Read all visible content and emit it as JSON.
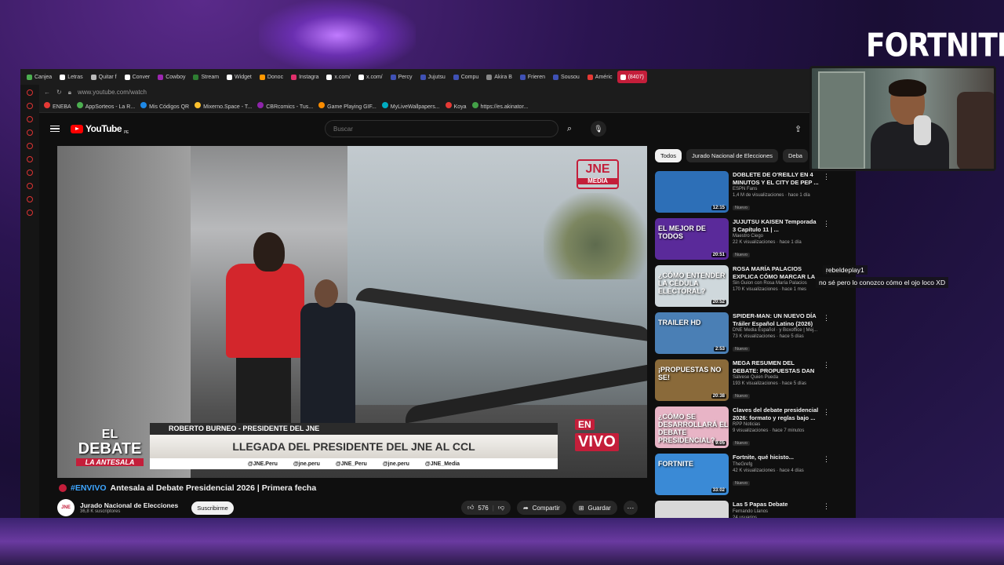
{
  "overlay": {
    "game_logo": "FORTNITE",
    "chat_user": "rebeldeplay1",
    "chat_message": "no sé pero lo conozco cómo el ojo loco XD"
  },
  "browser": {
    "url": "www.youtube.com/watch",
    "tabs": [
      {
        "label": "Canjea",
        "color": "#4caf50"
      },
      {
        "label": "Letras",
        "color": "#ffffff"
      },
      {
        "label": "Quitar f",
        "color": "#bbbbbb"
      },
      {
        "label": "Conver",
        "color": "#ffffff"
      },
      {
        "label": "Cowboy",
        "color": "#9c27b0"
      },
      {
        "label": "Stream",
        "color": "#2e7d32"
      },
      {
        "label": "Widget",
        "color": "#ffffff"
      },
      {
        "label": "Donoc",
        "color": "#ff9800"
      },
      {
        "label": "Instagra",
        "color": "#e1306c"
      },
      {
        "label": "x.com/",
        "color": "#ffffff"
      },
      {
        "label": "x.com/",
        "color": "#ffffff"
      },
      {
        "label": "Percy",
        "color": "#3f51b5"
      },
      {
        "label": "Jujutsu",
        "color": "#3f51b5"
      },
      {
        "label": "Compu",
        "color": "#3f51b5"
      },
      {
        "label": "Akira B",
        "color": "#888888"
      },
      {
        "label": "Frieren",
        "color": "#3f51b5"
      },
      {
        "label": "Sousou",
        "color": "#3f51b5"
      },
      {
        "label": "Améric",
        "color": "#e53935"
      },
      {
        "label": "(8407)",
        "color": "#ffffff",
        "active": true
      }
    ],
    "bookmarks": [
      "ENEBA",
      "AppSorteos - La R...",
      "Mis Códigos QR",
      "Mixerno.Space - T...",
      "CBRcomics - Tus...",
      "Game Playing GIF...",
      "MyLiveWallpapers...",
      "Koya",
      "https://es.akinator..."
    ]
  },
  "youtube": {
    "logo_text": "YouTube",
    "logo_country": "PE",
    "search_placeholder": "Buscar",
    "video": {
      "overlay_brand": "JNE",
      "overlay_brand_sub": "MEDIA",
      "badge_line1": "EL",
      "badge_line2": "DEBATE",
      "badge_line3": "LA ANTESALA",
      "name_strip": "ROBERTO BURNEO - PRESIDENTE DEL JNE",
      "headline": "LLEGADA DEL PRESIDENTE DEL JNE AL CCL",
      "socials": [
        "@JNE.Peru",
        "@jne.peru",
        "@JNE_Peru",
        "@jne.peru",
        "@JNE_Media"
      ],
      "live_en": "EN",
      "live_vivo": "VIVO"
    },
    "title_hashtag": "#ENVIVO",
    "title_text": "Antesala al Debate Presidencial 2026 | Primera fecha",
    "channel_name": "Jurado Nacional de Elecciones",
    "channel_subs": "36,8 K suscriptores",
    "channel_avatar_text": "JNE",
    "subscribe_label": "Suscribirme",
    "like_count": "576",
    "share_label": "Compartir",
    "save_label": "Guardar",
    "chips": [
      "Todos",
      "Jurado Nacional de Elecciones",
      "Deba"
    ],
    "recommendations": [
      {
        "title": "DOBLETE DE O'REILLY EN 4 MINUTOS Y EL CITY DE PEP ...",
        "channel": "ESPN Fans",
        "stats": "1,4 M de visualizaciones · hace 1 día",
        "badge": "Nuevo",
        "duration": "12:15",
        "thumb_text": "",
        "thumb_color": "#2d6fb7"
      },
      {
        "title": "JUJUTSU KAISEN Temporada 3 Capítulo 11 | ...",
        "channel": "Maestro Ciego",
        "stats": "22 K visualizaciones · hace 1 día",
        "badge": "Nuevo",
        "duration": "20:51",
        "thumb_text": "EL MEJOR DE TODOS",
        "thumb_color": "#5a2a9a"
      },
      {
        "title": "ROSA MARÍA PALACIOS EXPLICA CÓMO MARCAR LA ...",
        "channel": "Sin Guion con Rosa María Palacios",
        "stats": "170 K visualizaciones · hace 1 mes",
        "badge": "",
        "duration": "20:52",
        "thumb_text": "¿CÓMO ENTENDER LA CÉDULA ELECTORAL?",
        "thumb_color": "#cfd8dc"
      },
      {
        "title": "SPIDER-MAN: UN NUEVO DÍA Tráiler Español Latino (2026)",
        "channel": "DNE Media Español · y Boxoffice | Mej...",
        "stats": "73 K visualizaciones · hace 5 días",
        "badge": "Nuevo",
        "duration": "2:53",
        "thumb_text": "TRAILER HD",
        "thumb_color": "#4a7fb5"
      },
      {
        "title": "MEGA RESUMEN DEL DEBATE: PROPUESTAS DAN PENA ...",
        "channel": "Sálvese Quien Pueda",
        "stats": "193 K visualizaciones · hace 5 días",
        "badge": "Nuevo",
        "duration": "20:38",
        "thumb_text": "¡PROPUESTAS NO SE!",
        "thumb_color": "#8a6a3a"
      },
      {
        "title": "Claves del debate presidencial 2026: formato y reglas bajo ...",
        "channel": "RPP Noticias",
        "stats": "9 visualizaciones · hace 7 minutos",
        "badge": "Nuevo",
        "duration": "9:05",
        "thumb_text": "¿CÓMO SE DESARROLLARÁ EL DEBATE PRESIDENCIAL?",
        "thumb_color": "#e8b4c6"
      },
      {
        "title": "Fortnite, qué hicisto...",
        "channel": "TheGrefg",
        "stats": "42 K visualizaciones · hace 4 días",
        "badge": "Nuevo",
        "duration": "33:02",
        "thumb_text": "FORTNITE",
        "thumb_color": "#3a8ad6"
      },
      {
        "title": "Las 5 Papas Debate",
        "channel": "Fernando Llanos",
        "stats": "24 usuarios",
        "badge": "",
        "duration": "",
        "thumb_text": "",
        "thumb_color": "#d8d8d8"
      }
    ]
  }
}
